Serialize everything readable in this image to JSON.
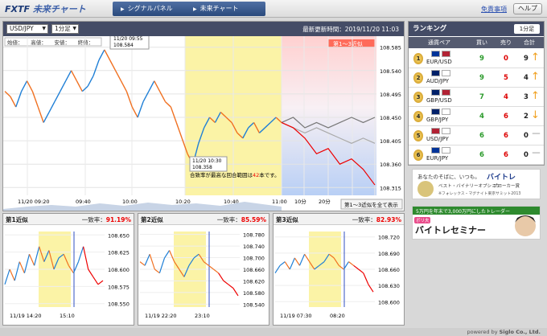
{
  "header": {
    "logo_prefix": "FXTF",
    "logo_main": "未来チャート",
    "tabs": [
      "シグナルパネル",
      "未来チャート"
    ],
    "disclaimer": "免責事項",
    "help": "ヘルプ"
  },
  "main_chart": {
    "pair": "USD/JPY",
    "timeframe": "1分足",
    "updated": "最新更新時間：2019/11/20 11:03",
    "ohlc": "始値：　　高値：　　安値：　　終値：",
    "tooltip_top": [
      "11/20 09:55",
      "108.584"
    ],
    "tooltip_bottom": [
      "11/20 10:30",
      "108.358"
    ],
    "annotation_prefix": "合致率が最高な回合範囲は",
    "annotation_num": "42",
    "annotation_suffix": "本です。",
    "forecast_label": "第1～3近似",
    "show_all": "第1～3近似を全て表示",
    "colors": {
      "highlight": "#fbf3a6",
      "forecast_top": "#ffd0d0",
      "forecast_bottom": "#b8cff5",
      "up": "#1f7fd6",
      "down": "#f07020"
    }
  },
  "chart_data": [
    {
      "type": "line",
      "title": "",
      "x_ticks": [
        "11/20 09:20",
        "09:40",
        "10:00",
        "10:20",
        "10:40",
        "11:00",
        "10分",
        "20分",
        "30分",
        "40分"
      ],
      "y_ticks": [
        108.585,
        108.54,
        108.495,
        108.45,
        108.405,
        108.36,
        108.315
      ],
      "ylim": [
        108.3,
        108.6
      ],
      "series": [
        {
          "values": [
            108.5,
            108.49,
            108.47,
            108.5,
            108.52,
            108.5,
            108.47,
            108.44,
            108.46,
            108.48,
            108.5,
            108.52,
            108.54,
            108.52,
            108.5,
            108.51,
            108.53,
            108.56,
            108.58,
            108.56,
            108.54,
            108.52,
            108.5,
            108.47,
            108.45,
            108.48,
            108.5,
            108.52,
            108.5,
            108.48,
            108.47,
            108.44,
            108.41,
            108.38,
            108.36,
            108.4,
            108.43,
            108.45,
            108.44,
            108.46,
            108.45,
            108.44,
            108.42,
            108.41,
            108.43,
            108.44,
            108.42,
            108.43,
            108.44,
            108.45,
            108.44
          ]
        },
        {
          "name": "forecast-gray-1",
          "values": [
            108.44,
            108.45,
            108.43,
            108.44,
            108.43,
            108.44,
            108.45,
            108.44,
            108.45
          ]
        },
        {
          "name": "forecast-gray-2",
          "values": [
            108.44,
            108.43,
            108.42,
            108.43,
            108.42,
            108.41,
            108.4,
            108.41,
            108.4
          ]
        },
        {
          "name": "forecast-red",
          "values": [
            108.44,
            108.43,
            108.41,
            108.38,
            108.39,
            108.36,
            108.37,
            108.35,
            108.32
          ]
        }
      ]
    },
    {
      "type": "line",
      "title": "第1近似",
      "x_ticks": [
        "11/19 14:20",
        "15:10"
      ],
      "y_ticks": [
        108.65,
        108.625,
        108.6,
        108.575,
        108.55
      ],
      "ylim": [
        108.545,
        108.655
      ]
    },
    {
      "type": "line",
      "title": "第2近似",
      "x_ticks": [
        "11/19 22:20",
        "23:10"
      ],
      "y_ticks": [
        108.78,
        108.74,
        108.7,
        108.66,
        108.62,
        108.58,
        108.54
      ],
      "ylim": [
        108.53,
        108.79
      ]
    },
    {
      "type": "line",
      "title": "第3近似",
      "x_ticks": [
        "11/19 07:30",
        "08:20"
      ],
      "y_ticks": [
        108.72,
        108.69,
        108.66,
        108.63,
        108.6
      ],
      "ylim": [
        108.59,
        108.73
      ]
    }
  ],
  "subcharts": [
    {
      "label": "第1近似",
      "rate_label": "一致率：",
      "rate": "91.19%"
    },
    {
      "label": "第2近似",
      "rate_label": "一致率：",
      "rate": "85.59%"
    },
    {
      "label": "第3近似",
      "rate_label": "一致率：",
      "rate": "82.93%"
    }
  ],
  "ranking": {
    "title": "ランキング",
    "button": "1分足",
    "columns": [
      "通貨ペア",
      "買い",
      "売り",
      "合計"
    ],
    "rows": [
      {
        "rank": "1",
        "pair": "EUR/USD",
        "buy": "9",
        "sell": "0",
        "total": "9",
        "trend": "↑",
        "flags": [
          "#003399",
          "#b22234"
        ]
      },
      {
        "rank": "2",
        "pair": "AUD/JPY",
        "buy": "9",
        "sell": "5",
        "total": "4",
        "trend": "↑",
        "flags": [
          "#012169",
          "#ffffff"
        ]
      },
      {
        "rank": "3",
        "pair": "GBP/USD",
        "buy": "7",
        "sell": "4",
        "total": "3",
        "trend": "↑",
        "flags": [
          "#012169",
          "#b22234"
        ]
      },
      {
        "rank": "4",
        "pair": "GBP/JPY",
        "buy": "4",
        "sell": "6",
        "total": "2",
        "trend": "↓",
        "flags": [
          "#012169",
          "#ffffff"
        ]
      },
      {
        "rank": "5",
        "pair": "USD/JPY",
        "buy": "6",
        "sell": "6",
        "total": "0",
        "trend": "－",
        "flags": [
          "#b22234",
          "#ffffff"
        ]
      },
      {
        "rank": "6",
        "pair": "EUR/JPY",
        "buy": "6",
        "sell": "6",
        "total": "0",
        "trend": "－",
        "flags": [
          "#003399",
          "#ffffff"
        ]
      }
    ]
  },
  "ads": {
    "ad1_line1": "あなたのそばに、いつも。",
    "ad1_brand": "バイトレ",
    "ad1_line2": "ベスト・バイナリーオプション",
    "ad1_line3": "ブローカー賞",
    "ad1_line4": "※フォレックス・マグナイト東京サミット2013",
    "ad2_top": "5万円を年末で3,000万円にしたトレーダー",
    "ad2_tag": "ボリ夫",
    "ad2_main": "バイトレセミナー"
  },
  "footer": {
    "powered": "powered by",
    "company": "Siglo Co., Ltd."
  }
}
